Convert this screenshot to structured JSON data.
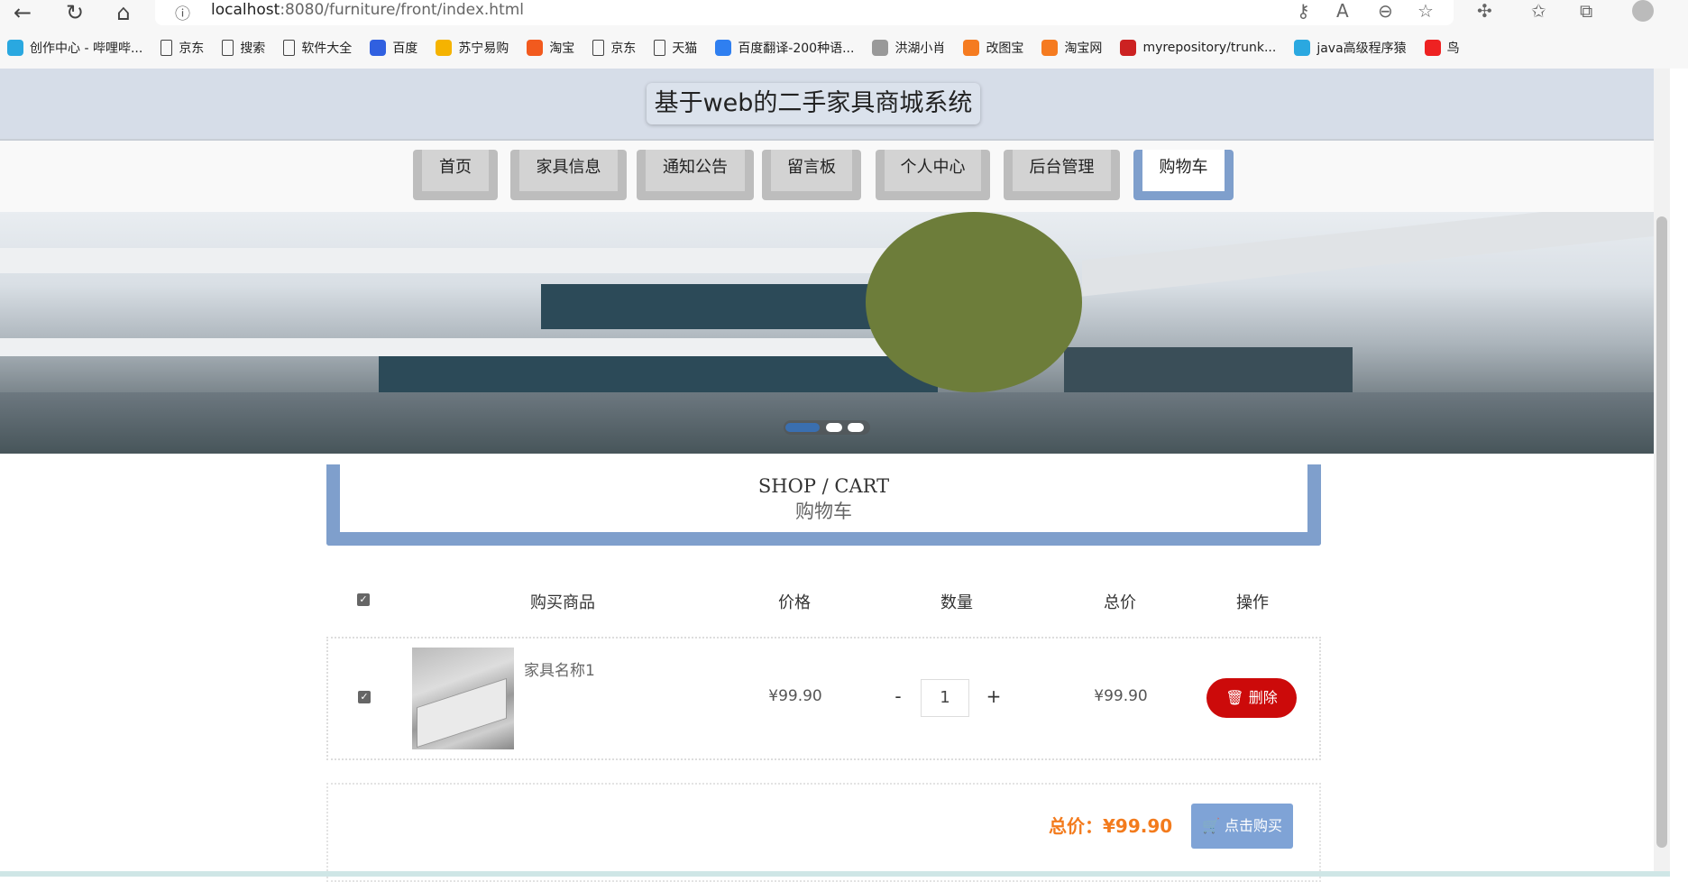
{
  "browser": {
    "url_host": "localhost",
    "url_rest": ":8080/furniture/front/index.html",
    "bookmarks": [
      {
        "label": "创作中心 - 哔哩哔...",
        "icon": "bilibili-icon",
        "color": "#2aa8e0"
      },
      {
        "label": "京东",
        "icon": "page-icon"
      },
      {
        "label": "搜索",
        "icon": "page-icon"
      },
      {
        "label": "软件大全",
        "icon": "page-icon"
      },
      {
        "label": "百度",
        "icon": "baidu-icon",
        "color": "#3060e0"
      },
      {
        "label": "苏宁易购",
        "icon": "suning-icon",
        "color": "#f5b300"
      },
      {
        "label": "淘宝",
        "icon": "taobao-icon",
        "color": "#f25a1e"
      },
      {
        "label": "京东",
        "icon": "page-icon"
      },
      {
        "label": "天猫",
        "icon": "page-icon"
      },
      {
        "label": "百度翻译-200种语...",
        "icon": "translate-icon",
        "color": "#2f7ff0"
      },
      {
        "label": "洪湖小肖",
        "icon": "bird-icon",
        "color": "#999"
      },
      {
        "label": "改图宝",
        "icon": "gaitubao-icon",
        "color": "#f57b20"
      },
      {
        "label": "淘宝网",
        "icon": "taobao-icon",
        "color": "#f57b20"
      },
      {
        "label": "myrepository/trunk...",
        "icon": "repo-icon",
        "color": "#c22"
      },
      {
        "label": "java高级程序猿",
        "icon": "bilibili-icon",
        "color": "#2aa8e0"
      },
      {
        "label": "鸟",
        "icon": "bird-red-icon",
        "color": "#e22"
      }
    ]
  },
  "site": {
    "title": "基于web的二手家具商城系统",
    "nav": [
      "首页",
      "家具信息",
      "通知公告",
      "留言板",
      "个人中心",
      "后台管理",
      "购物车"
    ],
    "active_nav": "购物车"
  },
  "section": {
    "en": "SHOP / CART",
    "cn": "购物车"
  },
  "cart": {
    "headers": [
      "购买商品",
      "价格",
      "数量",
      "总价",
      "操作"
    ],
    "items": [
      {
        "checked": true,
        "name": "家具名称1",
        "price": "¥99.90",
        "qty": "1",
        "total": "¥99.90",
        "delete_label": "删除"
      }
    ],
    "minus": "-",
    "plus": "+",
    "total_label": "总价：¥99.90",
    "buy_label": "点击购买",
    "select_all": true
  },
  "colors": {
    "accent": "#7f9fcc",
    "delete": "#cc0a0a",
    "total": "#f37b1d",
    "buy": "#7fa3d6"
  }
}
